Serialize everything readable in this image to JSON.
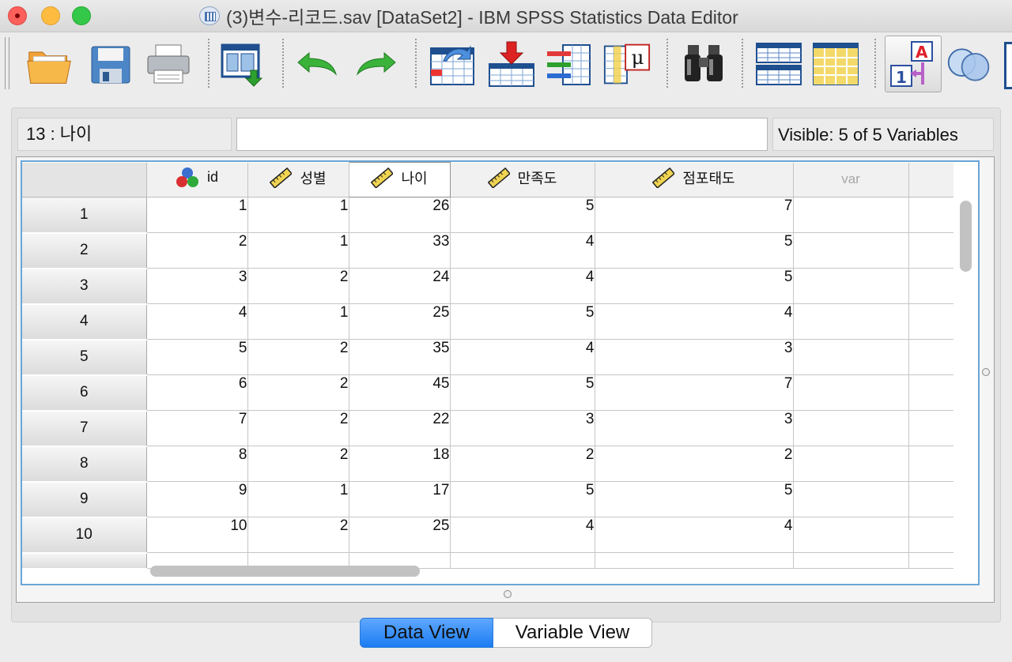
{
  "window": {
    "title": "(3)변수-리코드.sav [DataSet2] - IBM SPSS Statistics Data Editor"
  },
  "toolbar": {
    "buttons": [
      {
        "name": "open-data",
        "icon": "folder-open-icon"
      },
      {
        "name": "save",
        "icon": "floppy-disk-icon"
      },
      {
        "name": "print",
        "icon": "printer-icon"
      },
      {
        "name": "recall-dialog",
        "icon": "dialog-recall-icon"
      },
      {
        "name": "undo",
        "icon": "undo-arrow-icon"
      },
      {
        "name": "redo",
        "icon": "redo-arrow-icon"
      },
      {
        "name": "go-to-case",
        "icon": "goto-case-icon"
      },
      {
        "name": "go-to-variable",
        "icon": "goto-variable-icon"
      },
      {
        "name": "variables",
        "icon": "variables-icon"
      },
      {
        "name": "run-descriptives",
        "icon": "descriptives-icon"
      },
      {
        "name": "find",
        "icon": "binoculars-icon"
      },
      {
        "name": "insert-cases",
        "icon": "insert-cases-icon"
      },
      {
        "name": "insert-variable",
        "icon": "insert-variable-icon"
      },
      {
        "name": "value-labels",
        "icon": "value-labels-icon"
      },
      {
        "name": "use-variable-sets",
        "icon": "variable-sets-icon"
      }
    ]
  },
  "cell_reference": "13 : 나이",
  "cell_editor_value": "",
  "visible_variables": "Visible: 5 of 5 Variables",
  "grid": {
    "columns": [
      {
        "label": "id",
        "icon": "nominal-measure-icon"
      },
      {
        "label": "성별",
        "icon": "scale-ruler-icon"
      },
      {
        "label": "나이",
        "icon": "scale-ruler-icon",
        "selected": true
      },
      {
        "label": "만족도",
        "icon": "scale-ruler-icon"
      },
      {
        "label": "점포태도",
        "icon": "scale-ruler-icon"
      },
      {
        "label": "var",
        "icon": ""
      }
    ],
    "rows": [
      {
        "n": "1",
        "cells": [
          "1",
          "1",
          "26",
          "5",
          "7"
        ]
      },
      {
        "n": "2",
        "cells": [
          "2",
          "1",
          "33",
          "4",
          "5"
        ]
      },
      {
        "n": "3",
        "cells": [
          "3",
          "2",
          "24",
          "4",
          "5"
        ]
      },
      {
        "n": "4",
        "cells": [
          "4",
          "1",
          "25",
          "5",
          "4"
        ]
      },
      {
        "n": "5",
        "cells": [
          "5",
          "2",
          "35",
          "4",
          "3"
        ]
      },
      {
        "n": "6",
        "cells": [
          "6",
          "2",
          "45",
          "5",
          "7"
        ]
      },
      {
        "n": "7",
        "cells": [
          "7",
          "2",
          "22",
          "3",
          "3"
        ]
      },
      {
        "n": "8",
        "cells": [
          "8",
          "2",
          "18",
          "2",
          "2"
        ]
      },
      {
        "n": "9",
        "cells": [
          "9",
          "1",
          "17",
          "5",
          "5"
        ]
      },
      {
        "n": "10",
        "cells": [
          "10",
          "2",
          "25",
          "4",
          "4"
        ]
      }
    ]
  },
  "tabs": {
    "data_view": "Data View",
    "variable_view": "Variable View",
    "active": "Data View"
  },
  "colors": {
    "accent_tab": "#1c7cf2",
    "grid_frame": "#6aa5d9"
  }
}
